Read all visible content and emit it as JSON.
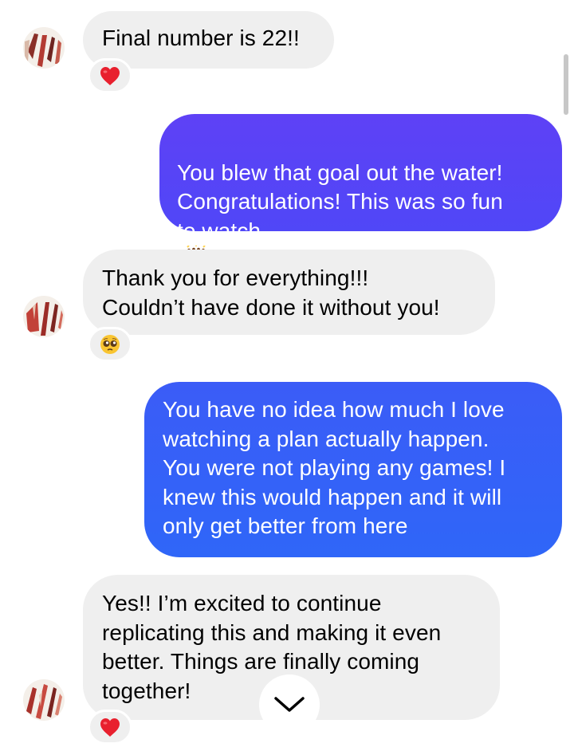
{
  "conversation": {
    "messages": [
      {
        "sender": "contact",
        "text": "Final number is 22!!",
        "reaction": "red-heart"
      },
      {
        "sender": "me",
        "text": "You blew that goal out the water!\nCongratulations! This was so fun\nto watch",
        "emoji": "raising-hands"
      },
      {
        "sender": "contact",
        "text": "Thank you for everything!!!\nCouldn’t have done it without you!",
        "reaction": "pleading-face"
      },
      {
        "sender": "me",
        "text": "You have no idea how much I love\nwatching a plan actually happen.\nYou were not playing any games! I\nknew this would happen and it will\nonly get better from here"
      },
      {
        "sender": "contact",
        "text": "Yes!! I’m excited to continue\nreplicating this and making it even\nbetter. Things are finally coming\ntogether!",
        "reaction": "red-heart"
      }
    ]
  },
  "colors": {
    "incoming_bubble": "#efefef",
    "outgoing_gradient_top": "#5e41f6",
    "outgoing_gradient_bottom": "#2f66f8",
    "outgoing_text": "#ffffff",
    "incoming_text": "#000000",
    "heart": "#e8202e",
    "scroll_icon": "#000000"
  },
  "icons": {
    "scroll_down": "chevron-down-icon",
    "scrollbar": "scrollbar"
  }
}
